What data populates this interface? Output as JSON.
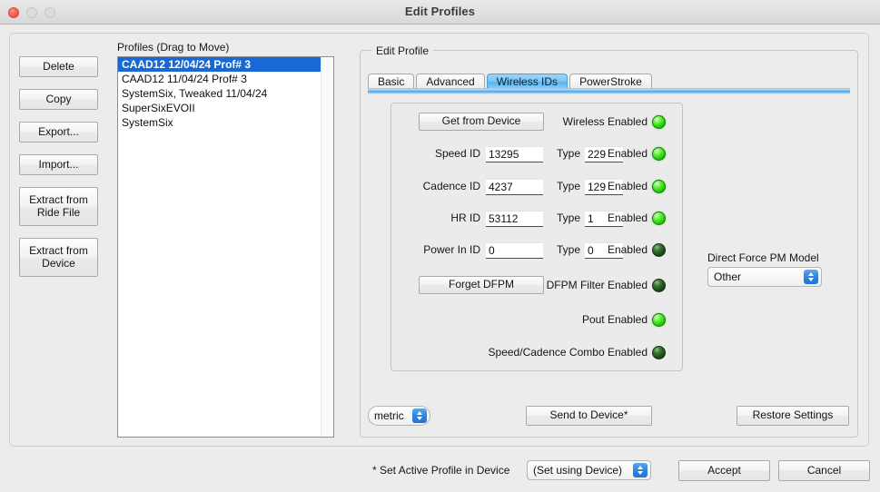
{
  "window": {
    "title": "Edit Profiles",
    "traffic_lights": [
      "close",
      "minimize",
      "maximize"
    ]
  },
  "sidebar": {
    "buttons": [
      {
        "label": "Delete",
        "name": "delete-button"
      },
      {
        "label": "Copy",
        "name": "copy-button"
      },
      {
        "label": "Export...",
        "name": "export-button"
      },
      {
        "label": "Import...",
        "name": "import-button"
      },
      {
        "label": "Extract from Ride File",
        "name": "extract-from-ride-file-button"
      },
      {
        "label": "Extract from Device",
        "name": "extract-from-device-button"
      }
    ]
  },
  "profiles": {
    "label": "Profiles (Drag to Move)",
    "items": [
      {
        "label": "CAAD12 12/04/24 Prof# 3",
        "selected": true
      },
      {
        "label": "CAAD12 11/04/24 Prof# 3",
        "selected": false
      },
      {
        "label": "SystemSix, Tweaked 11/04/24",
        "selected": false
      },
      {
        "label": "SuperSixEVOII",
        "selected": false
      },
      {
        "label": "SystemSix",
        "selected": false
      }
    ],
    "selection_color": "#1869d6"
  },
  "edit_profile": {
    "group_title": "Edit Profile",
    "tabs": [
      {
        "label": "Basic",
        "active": false
      },
      {
        "label": "Advanced",
        "active": false
      },
      {
        "label": "Wireless IDs",
        "active": true
      },
      {
        "label": "PowerStroke",
        "active": false
      }
    ],
    "wireless": {
      "get_from_device_label": "Get from Device",
      "wireless_enabled_label": "Wireless Enabled",
      "wireless_enabled_state": "on",
      "rows": [
        {
          "label": "Speed ID",
          "id_value": "13295",
          "type_label": "Type",
          "type_value": "229",
          "enabled_label": "Enabled",
          "enabled_state": "on"
        },
        {
          "label": "Cadence ID",
          "id_value": "4237",
          "type_label": "Type",
          "type_value": "129",
          "enabled_label": "Enabled",
          "enabled_state": "on"
        },
        {
          "label": "HR ID",
          "id_value": "53112",
          "type_label": "Type",
          "type_value": "1",
          "enabled_label": "Enabled",
          "enabled_state": "on"
        },
        {
          "label": "Power In ID",
          "id_value": "0",
          "type_label": "Type",
          "type_value": "0",
          "enabled_label": "Enabled",
          "enabled_state": "off"
        }
      ],
      "forget_dfpm_label": "Forget DFPM",
      "dfpm_filter_label": "DFPM Filter Enabled",
      "dfpm_filter_state": "off",
      "pout_label": "Pout Enabled",
      "pout_state": "on",
      "speed_cadence_label": "Speed/Cadence Combo Enabled",
      "speed_cadence_state": "off"
    },
    "dfpm_model": {
      "label": "Direct Force PM Model",
      "value": "Other"
    },
    "units": {
      "value": "metric"
    },
    "send_to_device_label": "Send to Device*",
    "restore_settings_label": "Restore Settings"
  },
  "footer": {
    "note": "* Set Active Profile in Device",
    "active_profile_value": "(Set using Device)",
    "accept_label": "Accept",
    "cancel_label": "Cancel"
  },
  "colors": {
    "led_on": "#2fd60c",
    "led_off": "#1e4d1b",
    "selection": "#1869d6",
    "accent": "#2e86e0"
  }
}
